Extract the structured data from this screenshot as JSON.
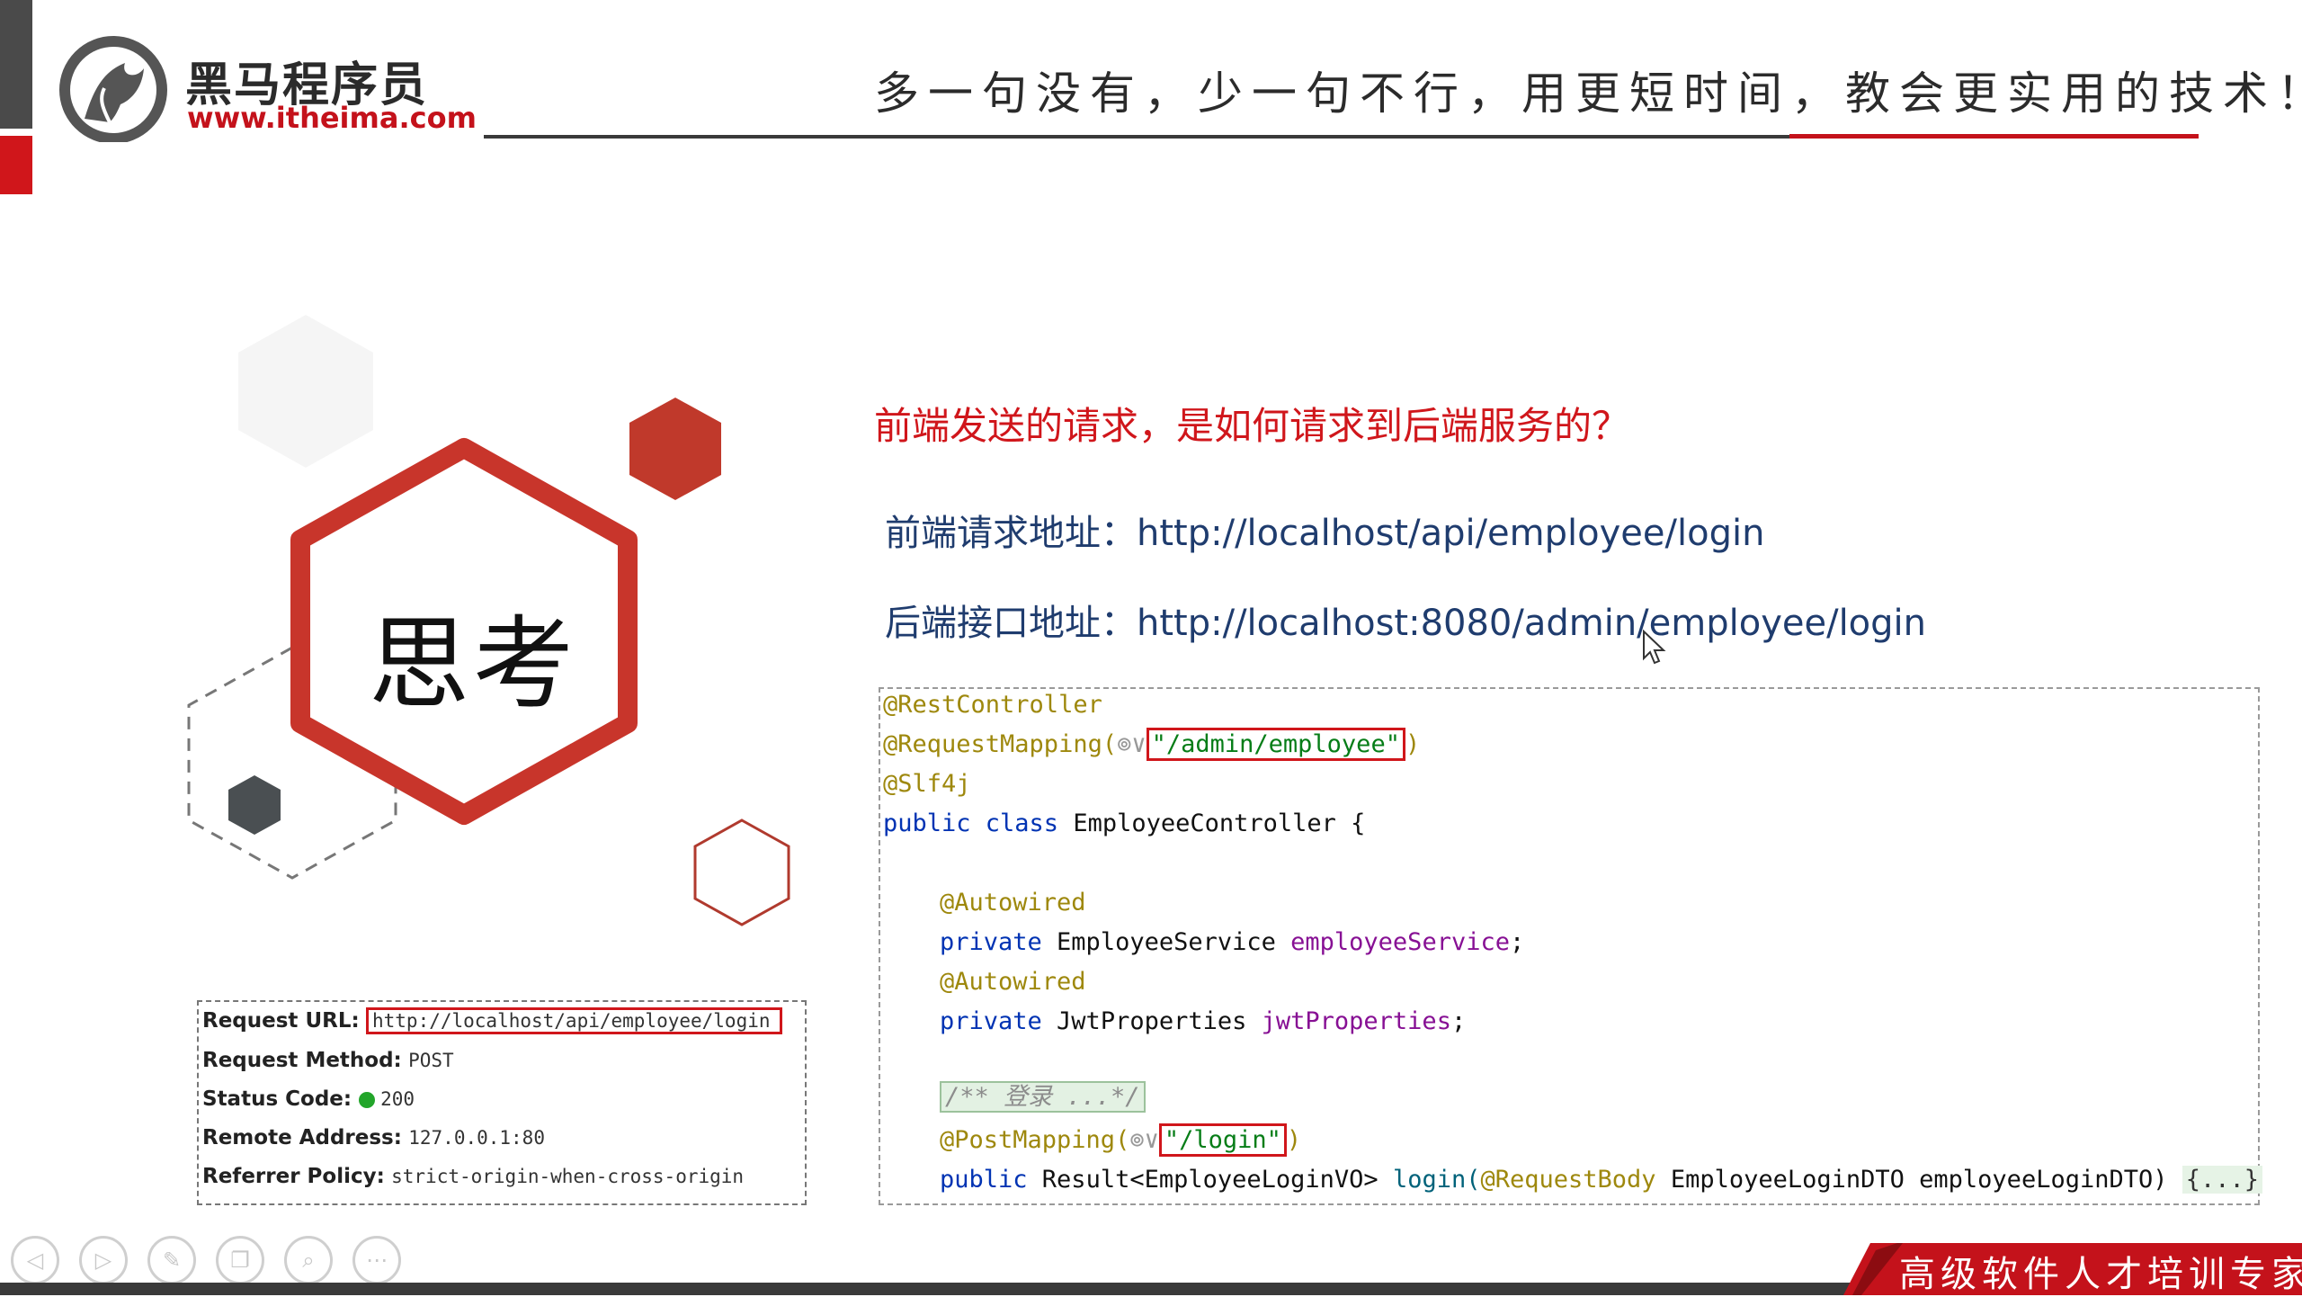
{
  "brand": {
    "name": "黑马程序员",
    "url": "www.itheima.com"
  },
  "slogan": "多一句没有，少一句不行，用更短时间，教会更实用的技术！",
  "think_label": "思考",
  "question": "前端发送的请求，是如何请求到后端服务的？",
  "addresses": [
    {
      "label": "前端请求地址：",
      "value": "http://localhost/api/employee/login"
    },
    {
      "label": "后端接口地址：",
      "value": "http://localhost:8080/admin/employee/login"
    }
  ],
  "code": {
    "l1": "@RestController",
    "l2_prefix": "@RequestMapping(",
    "l2_icon": "⊚∨",
    "l2_str": "\"/admin/employee\"",
    "l2_suffix": ")",
    "l3": "@Slf4j",
    "l4_kw": "public class ",
    "l4_name": "EmployeeController {",
    "l5": "@Autowired",
    "l6_kw": "private ",
    "l6_type": "EmployeeService ",
    "l6_field": "employeeService",
    "l6_end": ";",
    "l7": "@Autowired",
    "l8_kw": "private ",
    "l8_type": "JwtProperties ",
    "l8_field": "jwtProperties",
    "l8_end": ";",
    "l9": "/** 登录 ...*/",
    "l10_prefix": "@PostMapping(",
    "l10_icon": "⊚∨",
    "l10_str": "\"/login\"",
    "l10_suffix": ")",
    "l11_kw": "public ",
    "l11_type": "Result<EmployeeLoginVO> ",
    "l11_method": "login(",
    "l11_ann": "@RequestBody ",
    "l11_rest": "EmployeeLoginDTO employeeLoginDTO) ",
    "l11_fold": "{...}"
  },
  "request_info": {
    "url_label": "Request URL:",
    "url_value": "http://localhost/api/employee/login",
    "method_label": "Request Method:",
    "method_value": "POST",
    "status_label": "Status Code:",
    "status_value": "200",
    "remote_label": "Remote Address:",
    "remote_value": "127.0.0.1:80",
    "referrer_label": "Referrer Policy:",
    "referrer_value": "strict-origin-when-cross-origin"
  },
  "banner": "高级软件人才培训专家",
  "colors": {
    "accent_red": "#d0161b",
    "link_blue": "#1f3c6e",
    "hex_dark": "#4a4f52"
  }
}
